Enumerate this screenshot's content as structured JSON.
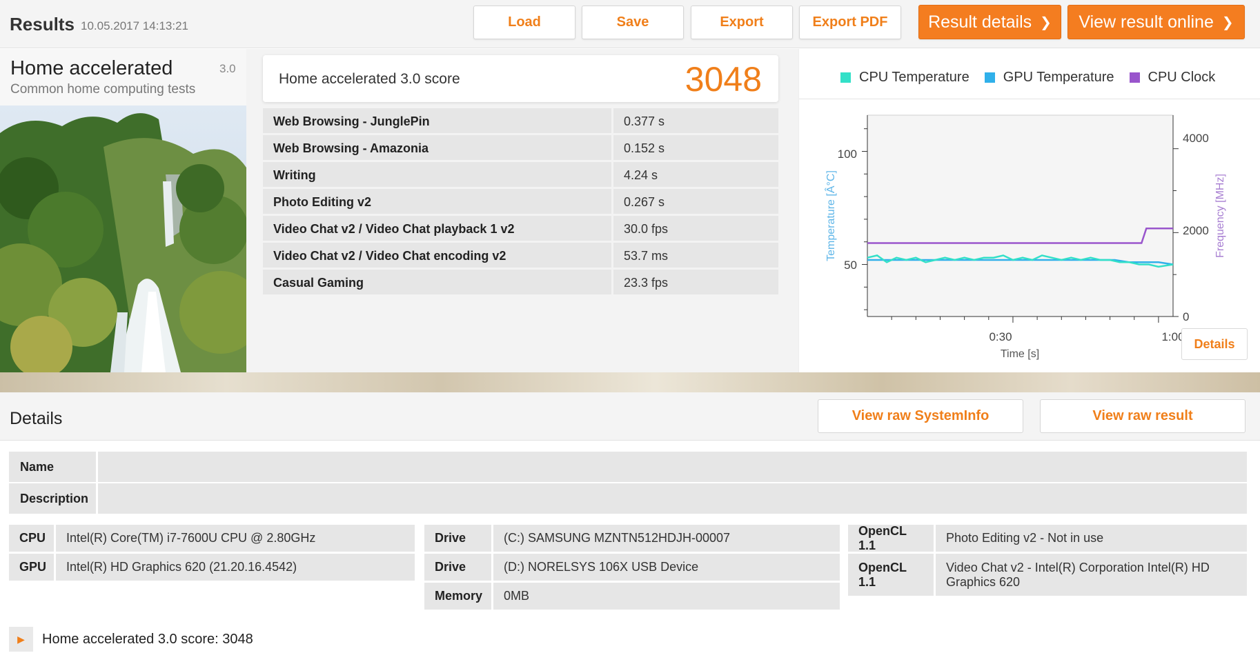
{
  "header": {
    "title": "Results",
    "timestamp": "10.05.2017 14:13:21",
    "buttons": {
      "load": "Load",
      "save": "Save",
      "export": "Export",
      "export_pdf": "Export PDF",
      "result_details": "Result details",
      "view_online": "View result online"
    }
  },
  "test": {
    "name": "Home accelerated",
    "version": "3.0",
    "subtitle": "Common home computing tests"
  },
  "score": {
    "label": "Home accelerated 3.0 score",
    "value": "3048"
  },
  "results": [
    {
      "name": "Web Browsing - JunglePin",
      "value": "0.377 s"
    },
    {
      "name": "Web Browsing - Amazonia",
      "value": "0.152 s"
    },
    {
      "name": "Writing",
      "value": "4.24 s"
    },
    {
      "name": "Photo Editing v2",
      "value": "0.267 s"
    },
    {
      "name": "Video Chat v2 / Video Chat playback 1 v2",
      "value": "30.0 fps"
    },
    {
      "name": "Video Chat v2 / Video Chat encoding v2",
      "value": "53.7 ms"
    },
    {
      "name": "Casual Gaming",
      "value": "23.3 fps"
    }
  ],
  "chart_data": {
    "type": "line",
    "legend": [
      "CPU Temperature",
      "GPU Temperature",
      "CPU Clock"
    ],
    "colors": {
      "cpu_temp": "#33e0c8",
      "gpu_temp": "#30b0ea",
      "cpu_clock": "#9955cc"
    },
    "xlabel": "Time [s]",
    "ylabel_left": "Temperature [Â°C]",
    "ylabel_right": "Frequency [MHz]",
    "x_ticks": [
      "0:30",
      "1:00"
    ],
    "y_left_ticks": [
      "50",
      "100"
    ],
    "y_right_ticks": [
      "0",
      "2000",
      "4000"
    ],
    "xlim": [
      0,
      63
    ],
    "ylim_left": [
      27,
      116
    ],
    "ylim_right": [
      0,
      4800
    ],
    "series": [
      {
        "name": "CPU Temperature",
        "axis": "left",
        "x": [
          0,
          2,
          4,
          6,
          8,
          10,
          12,
          14,
          16,
          18,
          20,
          22,
          24,
          26,
          28,
          30,
          32,
          34,
          36,
          38,
          40,
          42,
          44,
          46,
          48,
          50,
          52,
          54,
          56,
          58,
          60,
          63
        ],
        "values": [
          53,
          54,
          51,
          53,
          52,
          53,
          51,
          52,
          53,
          52,
          53,
          52,
          53,
          53,
          54,
          52,
          53,
          52,
          54,
          53,
          52,
          53,
          52,
          53,
          52,
          52,
          51,
          51,
          50,
          50,
          49,
          50
        ]
      },
      {
        "name": "GPU Temperature",
        "axis": "left",
        "x": [
          0,
          3,
          6,
          9,
          12,
          15,
          18,
          21,
          24,
          27,
          30,
          33,
          36,
          39,
          42,
          45,
          48,
          51,
          54,
          57,
          60,
          63
        ],
        "values": [
          52,
          52,
          52,
          52,
          52,
          52,
          52,
          52,
          52,
          52,
          52,
          52,
          52,
          52,
          52,
          52,
          52,
          52,
          51,
          51,
          51,
          50
        ]
      },
      {
        "name": "CPU Clock",
        "axis": "right",
        "x": [
          0,
          56.5,
          57.5,
          63
        ],
        "values": [
          1750,
          1750,
          2100,
          2100
        ]
      }
    ]
  },
  "chart_details_button": "Details",
  "details": {
    "title": "Details",
    "buttons": {
      "raw_systeminfo": "View raw SystemInfo",
      "raw_result": "View raw result"
    },
    "name_label": "Name",
    "name_value": "",
    "description_label": "Description",
    "description_value": "",
    "system_col1": [
      {
        "key": "CPU",
        "value": "Intel(R) Core(TM) i7-7600U CPU @ 2.80GHz"
      },
      {
        "key": "GPU",
        "value": "Intel(R) HD Graphics 620 (21.20.16.4542)"
      }
    ],
    "system_col2": [
      {
        "key": "Drive",
        "value": "(C:) SAMSUNG MZNTN512HDJH-00007"
      },
      {
        "key": "Drive",
        "value": "(D:) NORELSYS 106X USB Device"
      },
      {
        "key": "Memory",
        "value": "0MB"
      }
    ],
    "system_col3": [
      {
        "key": "OpenCL 1.1",
        "value": "Photo Editing v2 - Not in use"
      },
      {
        "key": "OpenCL 1.1",
        "value": "Video Chat v2 - Intel(R) Corporation Intel(R) HD Graphics 620"
      }
    ],
    "footer_score": "Home accelerated 3.0 score: 3048"
  }
}
